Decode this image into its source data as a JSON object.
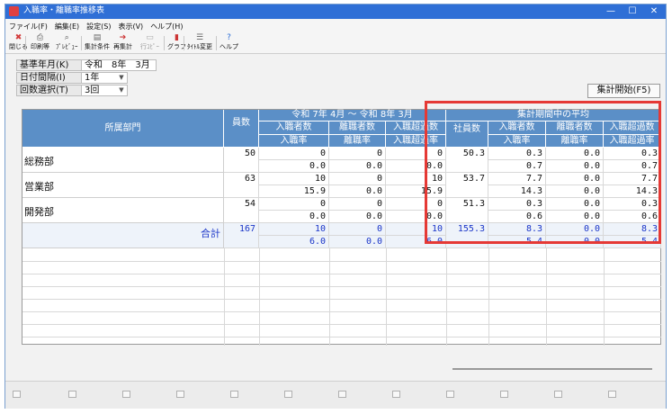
{
  "window": {
    "title": "入職率・離職率推移表",
    "min": "—",
    "max": "☐",
    "close": "✕"
  },
  "menu": [
    "ファイル(F)",
    "編集(E)",
    "設定(S)",
    "表示(V)",
    "ヘルプ(H)"
  ],
  "toolbar": [
    {
      "label": "閉じる",
      "icon": "close-doc-icon",
      "glyph": "✖",
      "color": "#d23a3a",
      "enabled": true
    },
    {
      "label": "印刷等",
      "icon": "printer-icon",
      "glyph": "⎙",
      "color": "#555555",
      "enabled": true
    },
    {
      "label": "ﾌﾟﾚﾋﾞｭｰ",
      "icon": "preview-icon",
      "glyph": "⌕",
      "color": "#555555",
      "enabled": true
    },
    {
      "label": "集計条件",
      "icon": "conditions-icon",
      "glyph": "▤",
      "color": "#666666",
      "enabled": true
    },
    {
      "label": "再集計",
      "icon": "recalc-icon",
      "glyph": "➔",
      "color": "#cc3333",
      "enabled": true
    },
    {
      "label": "行ｺﾋﾟｰ",
      "icon": "row-copy-icon",
      "glyph": "▭",
      "color": "#aaaaaa",
      "enabled": false
    },
    {
      "label": "グラフ",
      "icon": "graph-icon",
      "glyph": "▮",
      "color": "#cc3333",
      "enabled": true
    },
    {
      "label": "ﾀｲﾄﾙ変更",
      "icon": "title-change-icon",
      "glyph": "☰",
      "color": "#666666",
      "enabled": true
    },
    {
      "label": "ヘルプ",
      "icon": "help-icon",
      "glyph": "?",
      "color": "#2f6fd6",
      "enabled": true
    }
  ],
  "params": [
    {
      "label": "基準年月(K)",
      "value": "令和　8年　3月",
      "dropdown": false
    },
    {
      "label": "日付間隔(I)",
      "value": "1年",
      "dropdown": true
    },
    {
      "label": "回数選択(T)",
      "value": "3回",
      "dropdown": true
    }
  ],
  "start_button": "集計開始(F5)",
  "grid": {
    "period_header": "令和 7年 4月 ～ 令和 8年 3月",
    "avg_header": "集計期間中の平均",
    "dept_header": "所属部門",
    "headcount_header": "員数",
    "col_hire": "入職者数",
    "col_leave": "離職者数",
    "col_excess": "入職超過数",
    "col_hire_rate": "入職率",
    "col_leave_rate": "離職率",
    "col_excess_rate": "入職超過率",
    "avg_staff": "社員数",
    "rows": [
      {
        "name": "総務部",
        "headcount": "50",
        "top": [
          "0",
          "0",
          "0"
        ],
        "bottom": [
          "0.0",
          "0.0",
          "0.0"
        ],
        "avg_staff": "50.3",
        "avg_top": [
          "0.3",
          "0.0",
          "0.3"
        ],
        "avg_bottom": [
          "0.7",
          "0.0",
          "0.7"
        ]
      },
      {
        "name": "営業部",
        "headcount": "63",
        "top": [
          "10",
          "0",
          "10"
        ],
        "bottom": [
          "15.9",
          "0.0",
          "15.9"
        ],
        "avg_staff": "53.7",
        "avg_top": [
          "7.7",
          "0.0",
          "7.7"
        ],
        "avg_bottom": [
          "14.3",
          "0.0",
          "14.3"
        ]
      },
      {
        "name": "開発部",
        "headcount": "54",
        "top": [
          "0",
          "0",
          "0"
        ],
        "bottom": [
          "0.0",
          "0.0",
          "0.0"
        ],
        "avg_staff": "51.3",
        "avg_top": [
          "0.3",
          "0.0",
          "0.3"
        ],
        "avg_bottom": [
          "0.6",
          "0.0",
          "0.6"
        ]
      }
    ],
    "total": {
      "label": "合計",
      "headcount": "167",
      "top": [
        "10",
        "0",
        "10"
      ],
      "bottom": [
        "6.0",
        "0.0",
        "6.0"
      ],
      "avg_staff": "155.3",
      "avg_top": [
        "8.3",
        "0.0",
        "8.3"
      ],
      "avg_bottom": [
        "5.4",
        "0.0",
        "5.4"
      ]
    }
  },
  "colors": {
    "header_blue": "#5b8fc7",
    "highlight_red": "#e53935",
    "total_blue": "#1a35c8"
  }
}
